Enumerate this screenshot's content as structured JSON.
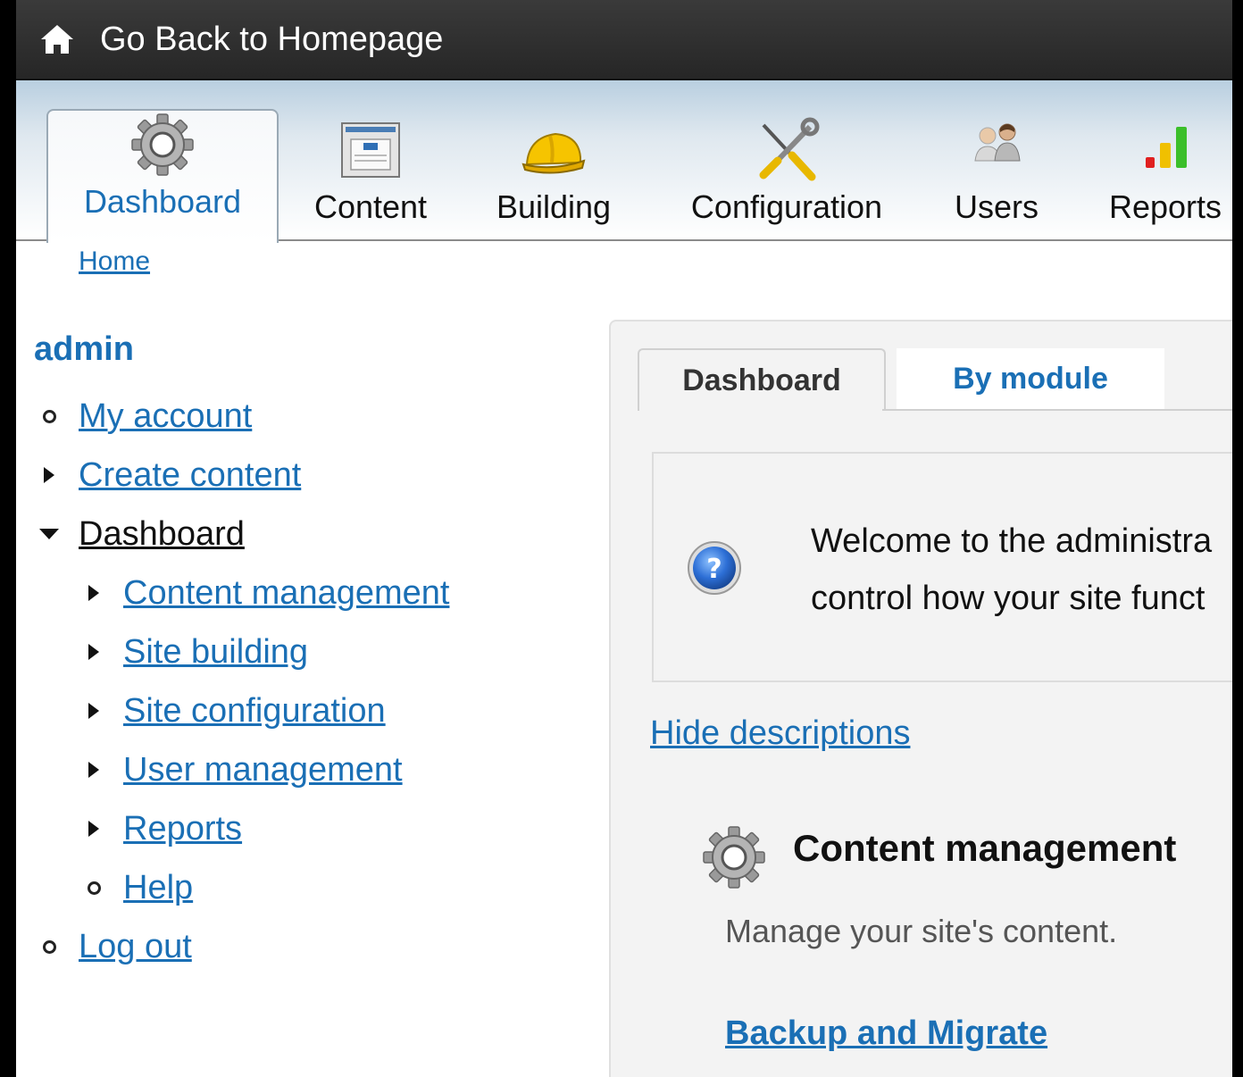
{
  "topbar": {
    "home_label": "Go Back to Homepage",
    "home_icon": "home-icon"
  },
  "toolbar": {
    "tabs": [
      {
        "label": "Dashboard",
        "icon": "gear-icon",
        "active": true
      },
      {
        "label": "Content",
        "icon": "content-icon",
        "active": false
      },
      {
        "label": "Building",
        "icon": "hard-hat-icon",
        "active": false
      },
      {
        "label": "Configuration",
        "icon": "tools-icon",
        "active": false
      },
      {
        "label": "Users",
        "icon": "users-icon",
        "active": false
      },
      {
        "label": "Reports",
        "icon": "bar-chart-icon",
        "active": false
      }
    ]
  },
  "breadcrumb": {
    "home": "Home"
  },
  "sidebar": {
    "title": "admin",
    "items": [
      {
        "label": "My account",
        "bullet": "circle"
      },
      {
        "label": "Create content",
        "bullet": "collapsed"
      },
      {
        "label": "Dashboard",
        "bullet": "expanded"
      },
      {
        "label": "Content management",
        "bullet": "collapsed"
      },
      {
        "label": "Site building",
        "bullet": "collapsed"
      },
      {
        "label": "Site configuration",
        "bullet": "collapsed"
      },
      {
        "label": "User management",
        "bullet": "collapsed"
      },
      {
        "label": "Reports",
        "bullet": "collapsed"
      },
      {
        "label": "Help",
        "bullet": "circle"
      },
      {
        "label": "Log out",
        "bullet": "circle"
      }
    ]
  },
  "panel": {
    "tabs": [
      {
        "label": "Dashboard",
        "active": true
      },
      {
        "label": "By module",
        "active": false
      }
    ],
    "welcome_line1": "Welcome to the administra",
    "welcome_line2": "control how your site funct",
    "hide_descriptions": "Hide descriptions",
    "section_title": "Content management",
    "section_desc": "Manage your site's content.",
    "section_link": "Backup and Migrate"
  },
  "colors": {
    "link": "#1a6fb5",
    "topbar": "#2e2e2e",
    "active_tab_text": "#1a6fb5"
  }
}
